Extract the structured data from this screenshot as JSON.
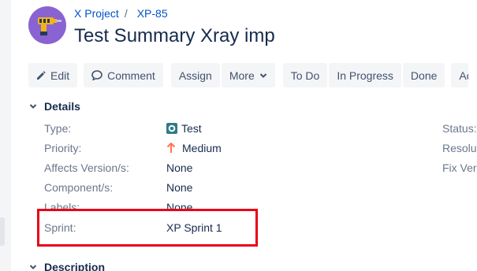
{
  "project": {
    "avatar_icon": "drill-icon",
    "breadcrumb": {
      "project_name": "X Project",
      "separator": "/",
      "issue_key": "XP-85"
    },
    "issue_title": "Test Summary Xray imp"
  },
  "toolbar": {
    "edit_label": "Edit",
    "comment_label": "Comment",
    "assign_label": "Assign",
    "more_label": "More",
    "todo_label": "To Do",
    "inprogress_label": "In Progress",
    "done_label": "Done",
    "overflow_label": "Ad"
  },
  "details": {
    "heading": "Details",
    "fields": [
      {
        "label": "Type:",
        "value": "Test",
        "icon": "test-type-icon"
      },
      {
        "label": "Priority:",
        "value": "Medium",
        "icon": "arrow-up-icon"
      },
      {
        "label": "Affects Version/s:",
        "value": "None"
      },
      {
        "label": "Component/s:",
        "value": "None"
      },
      {
        "label": "Labels:",
        "value": "None"
      },
      {
        "label": "Sprint:",
        "value": "XP Sprint 1"
      }
    ],
    "right_fields": [
      {
        "label": "Status:"
      },
      {
        "label": "Resolut"
      },
      {
        "label": "Fix Vers"
      }
    ]
  },
  "description": {
    "heading": "Description"
  },
  "colors": {
    "link": "#0052cc",
    "highlight": "#e8001a",
    "priority": "#ff7452",
    "test_type": "#2f7b8a",
    "avatar": "#8a63d2"
  }
}
